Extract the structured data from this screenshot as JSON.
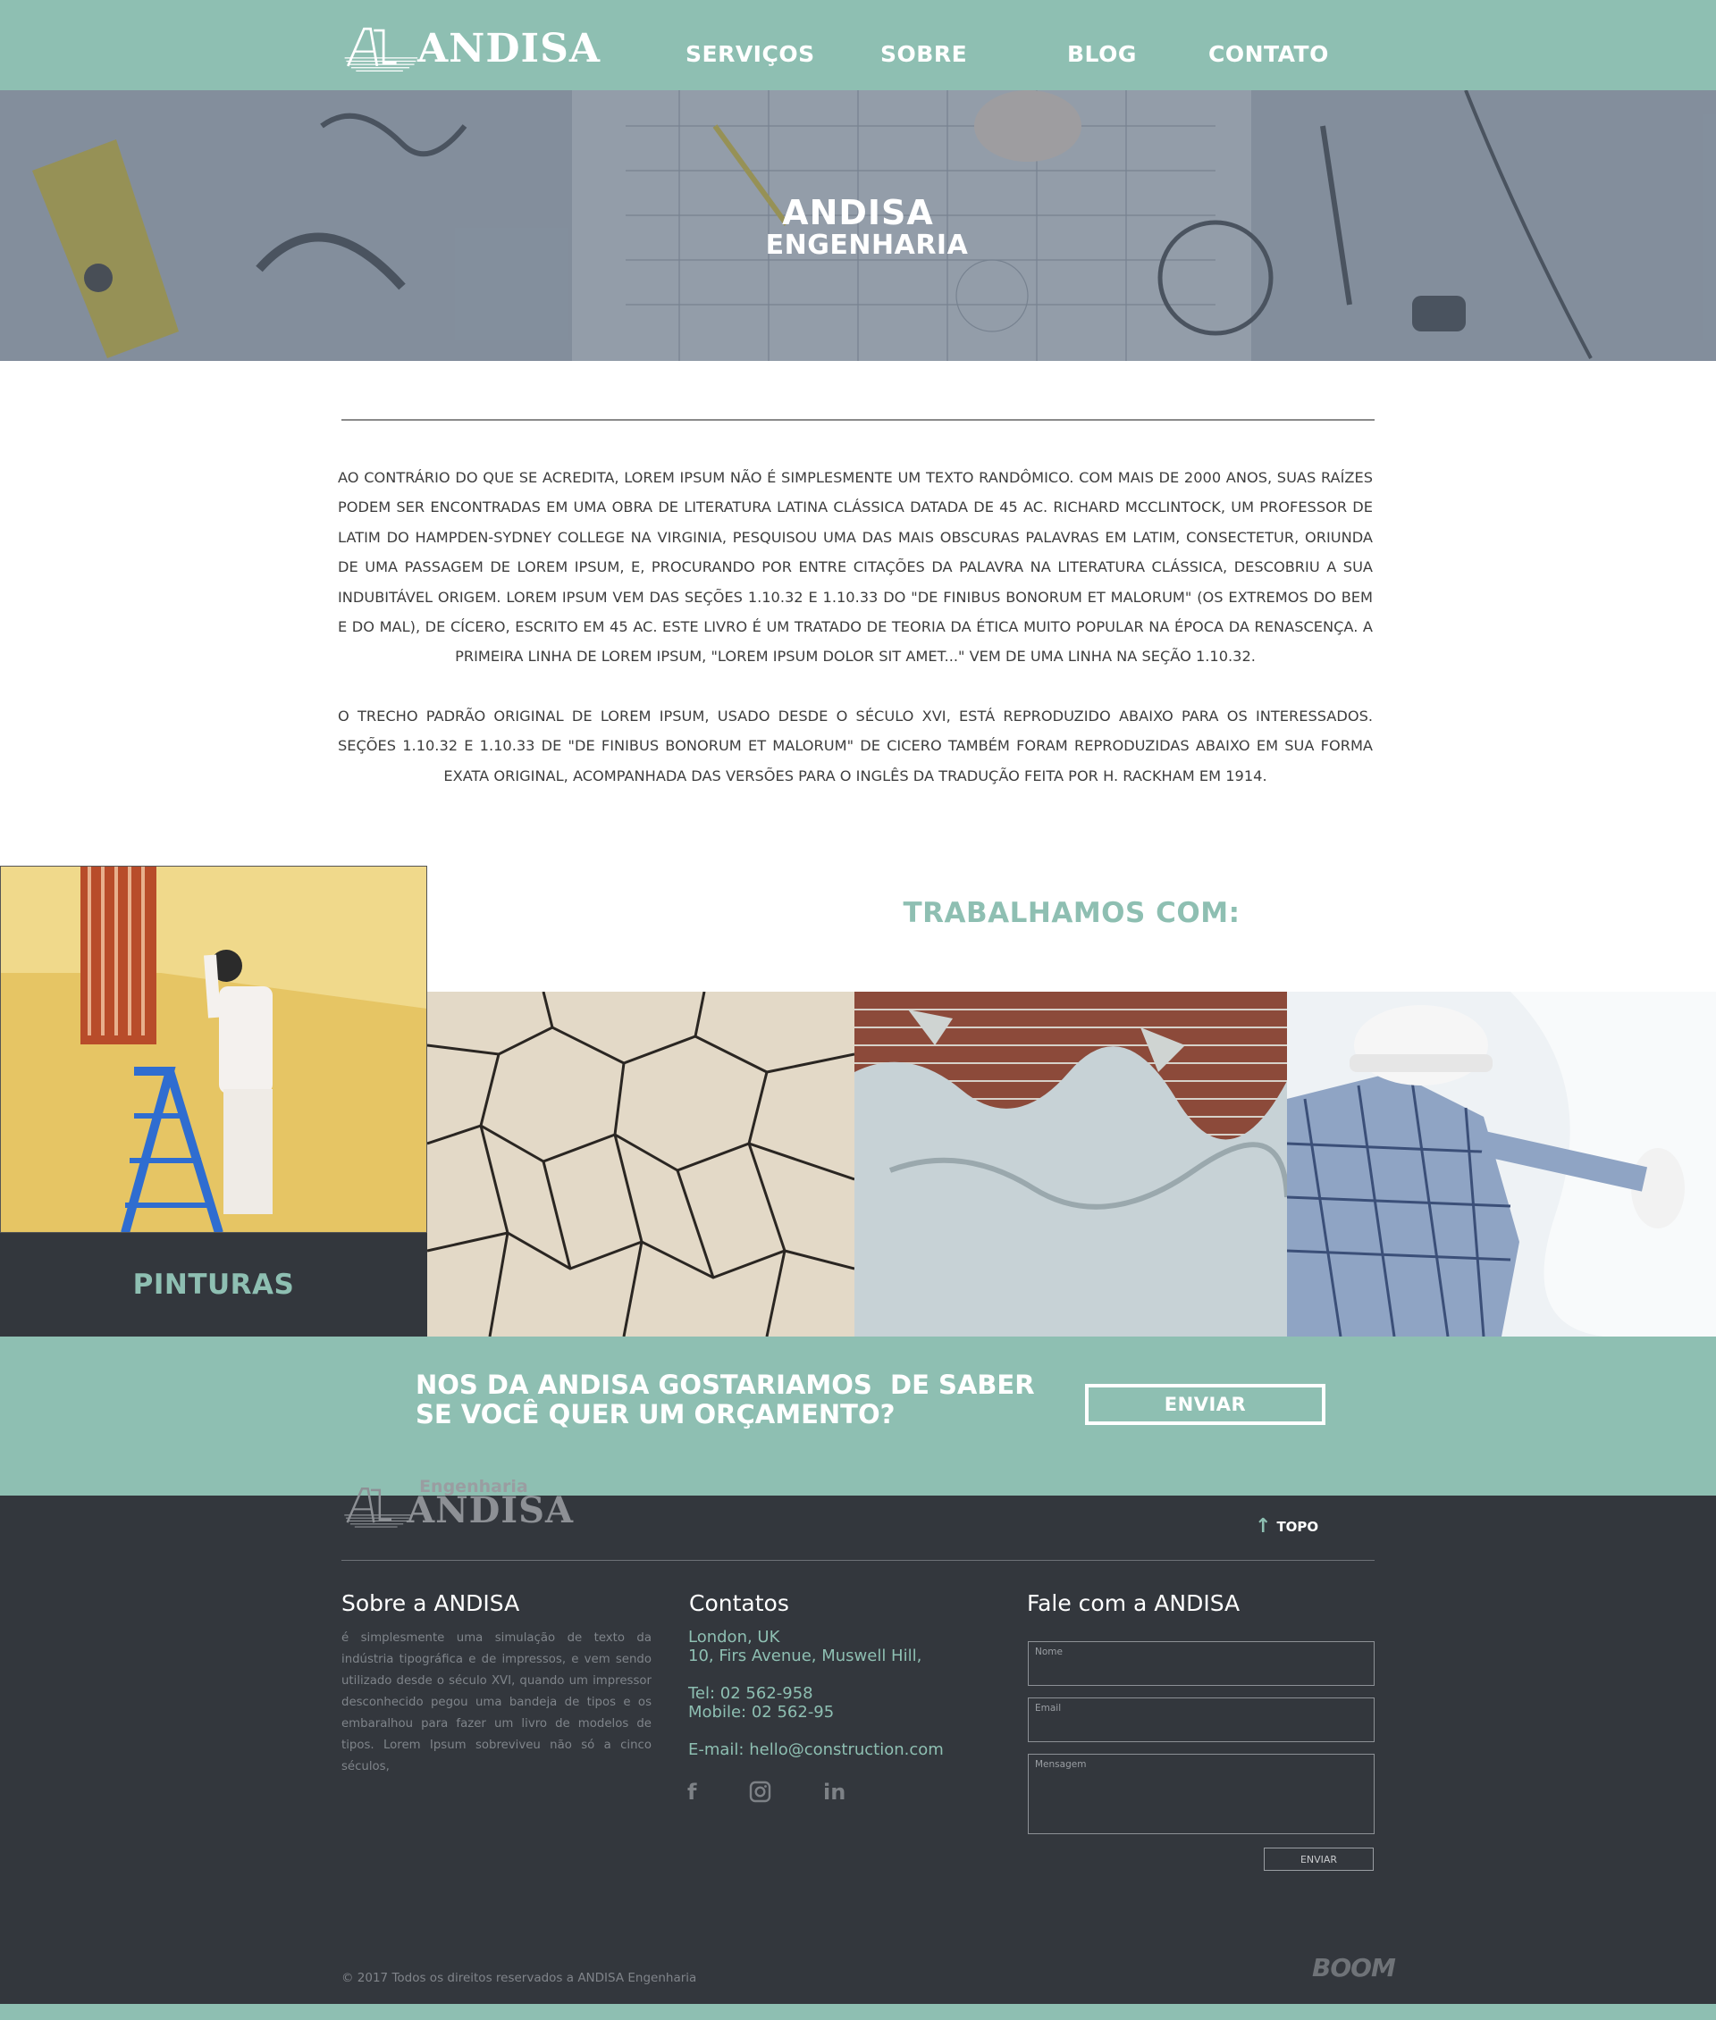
{
  "brand": {
    "name": "ANDISA",
    "footer_eng": "Engenharia",
    "footer_name": "ANDISA"
  },
  "nav": {
    "items": [
      {
        "label": "SERVIÇOS"
      },
      {
        "label": "SOBRE"
      },
      {
        "label": "BLOG"
      },
      {
        "label": "CONTATO"
      }
    ]
  },
  "hero": {
    "title": "ANDISA",
    "subtitle": "ENGENHARIA"
  },
  "intro": {
    "paragraphs": [
      "AO CONTRÁRIO DO QUE SE ACREDITA, LOREM IPSUM NÃO É SIMPLESMENTE UM TEXTO RANDÔMICO. COM MAIS DE 2000 ANOS, SUAS RAÍZES PODEM SER ENCONTRADAS EM UMA OBRA DE LITERATURA LATINA CLÁSSICA DATADA DE 45 AC. RICHARD MCCLINTOCK, UM PROFESSOR DE LATIM DO HAMPDEN-SYDNEY COLLEGE NA VIRGINIA, PESQUISOU UMA DAS MAIS OBSCURAS PALAVRAS EM LATIM, CONSECTETUR, ORIUNDA DE UMA PASSAGEM DE LOREM IPSUM, E, PROCURANDO POR ENTRE CITAÇÕES DA PALAVRA NA LITERATURA CLÁSSICA, DESCOBRIU A SUA INDUBITÁVEL ORIGEM. LOREM IPSUM VEM DAS SEÇÕES 1.10.32 E 1.10.33 DO \"DE FINIBUS BONORUM ET MALORUM\" (OS EXTREMOS DO BEM E DO MAL), DE CÍCERO, ESCRITO EM 45 AC. ESTE LIVRO É UM TRATADO DE TEORIA DA ÉTICA MUITO POPULAR NA ÉPOCA DA RENASCENÇA. A PRIMEIRA LINHA DE LOREM IPSUM, \"LOREM IPSUM DOLOR SIT AMET...\" VEM DE UMA LINHA NA SEÇÃO 1.10.32.",
      "O TRECHO PADRÃO ORIGINAL DE LOREM IPSUM, USADO DESDE O SÉCULO XVI, ESTÁ REPRODUZIDO ABAIXO PARA OS INTERESSADOS. SEÇÕES 1.10.32 E 1.10.33 DE \"DE FINIBUS BONORUM ET MALORUM\" DE CICERO TAMBÉM FORAM REPRODUZIDAS ABAIXO EM SUA FORMA EXATA ORIGINAL, ACOMPANHADA DAS VERSÕES PARA O INGLÊS DA TRADUÇÃO FEITA POR H. RACKHAM EM 1914."
    ]
  },
  "services": {
    "heading": "TRABALHAMOS COM:",
    "featured_label": "PINTURAS"
  },
  "cta": {
    "text_line1": "NOS DA ANDISA GOSTARIAMOS  DE SABER",
    "text_line2": "SE VOCÊ QUER UM ORÇAMENTO?",
    "button": "ENVIAR"
  },
  "footer": {
    "topo": "TOPO",
    "about": {
      "title": "Sobre a ANDISA",
      "text": "é simplesmente uma simulação de texto da indústria tipográfica e de impressos, e vem sendo utilizado desde o século XVI, quando um impressor desconhecido pegou uma bandeja de tipos e os embaralhou para fazer um livro de modelos de tipos. Lorem Ipsum sobreviveu não só a cinco séculos,"
    },
    "contacts": {
      "title": "Contatos",
      "city": "London, UK",
      "address": "10, Firs Avenue, Muswell Hill,",
      "tel": "Tel: 02 562-958",
      "mobile": "Mobile: 02 562-95",
      "email": "E-mail: hello@construction.com",
      "social": [
        {
          "icon": "facebook-icon",
          "glyph": "f"
        },
        {
          "icon": "instagram-icon"
        },
        {
          "icon": "linkedin-icon",
          "glyph": "in"
        }
      ]
    },
    "form": {
      "title": "Fale com a ANDISA",
      "name_label": "Nome",
      "email_label": "Email",
      "message_label": "Mensagem",
      "send": "ENVIAR"
    },
    "copyright": "© 2017  Todos os direitos reservados a ANDISA Engenharia",
    "signature": "BOOM"
  },
  "colors": {
    "accent": "#8ebfb2",
    "dark": "#33373d",
    "hero_overlay": "#6b7a8a"
  }
}
